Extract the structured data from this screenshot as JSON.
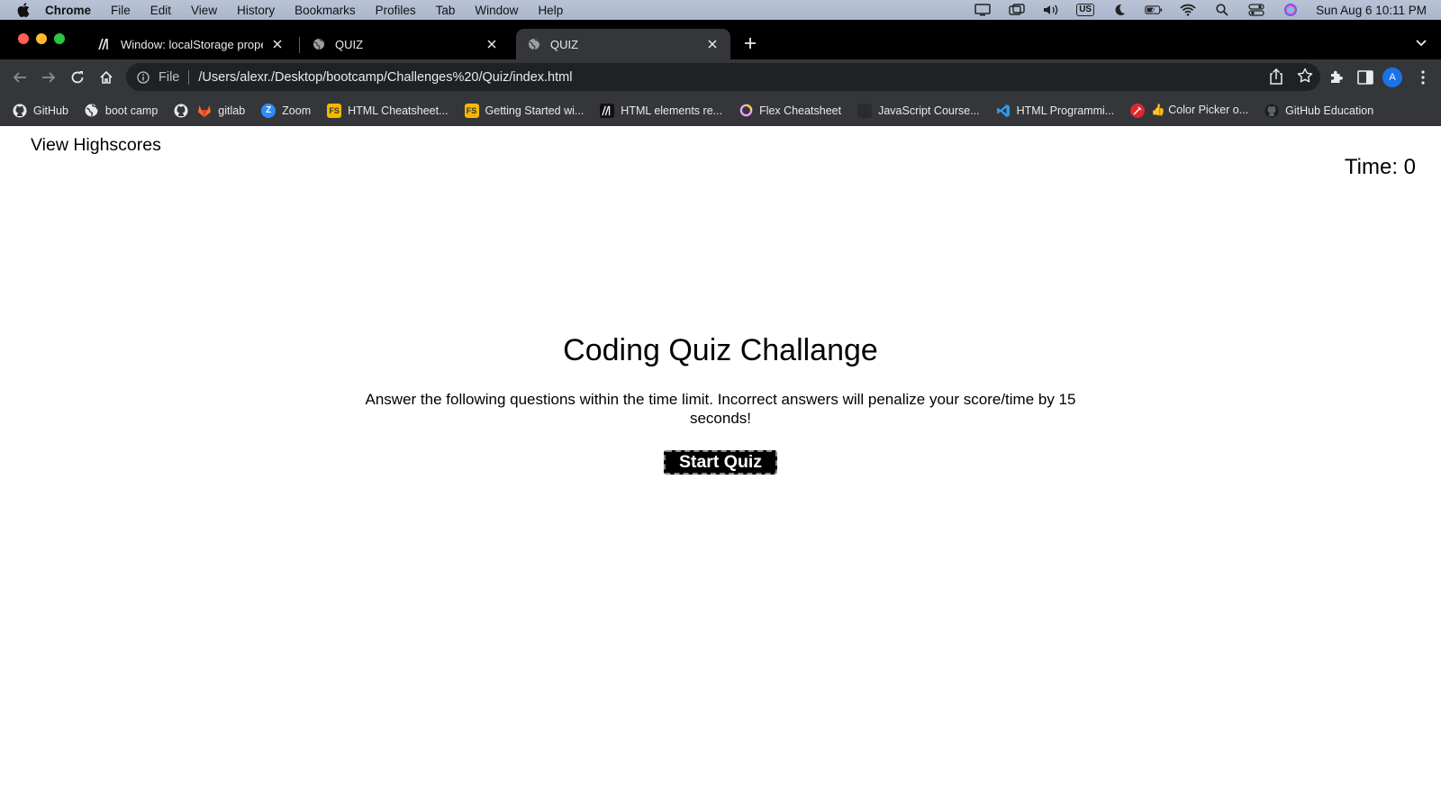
{
  "menubar": {
    "app_name": "Chrome",
    "items": [
      "File",
      "Edit",
      "View",
      "History",
      "Bookmarks",
      "Profiles",
      "Tab",
      "Window",
      "Help"
    ],
    "keyboard_layout": "US",
    "clock": "Sun Aug 6  10:11 PM"
  },
  "tabs": [
    {
      "title": "Window: localStorage property",
      "icon": "mdn-icon"
    },
    {
      "title": "QUIZ",
      "icon": "globe-icon"
    },
    {
      "title": "QUIZ",
      "icon": "globe-icon",
      "active": true
    }
  ],
  "toolbar": {
    "scheme_label": "File",
    "url": "/Users/alexr./Desktop/bootcamp/Challenges%20/Quiz/index.html",
    "avatar_letter": "A"
  },
  "bookmarks": [
    {
      "label": "GitHub",
      "icon": "github-icon"
    },
    {
      "label": "boot camp",
      "icon": "globe-icon"
    },
    {
      "label": "",
      "icon": "github-icon"
    },
    {
      "label": "gitlab",
      "icon": "gitlab-icon"
    },
    {
      "label": "Zoom",
      "icon": "zoom-icon"
    },
    {
      "label": "HTML Cheatsheet...",
      "icon": "fs-icon"
    },
    {
      "label": "Getting Started wi...",
      "icon": "fs-icon"
    },
    {
      "label": "HTML elements re...",
      "icon": "mdn-icon"
    },
    {
      "label": "Flex Cheatsheet",
      "icon": "ring-icon"
    },
    {
      "label": "JavaScript Course...",
      "icon": "blank-icon"
    },
    {
      "label": "HTML Programmi...",
      "icon": "vscode-icon"
    },
    {
      "label": "👍 Color Picker o...",
      "icon": "picker-icon"
    },
    {
      "label": "GitHub Education",
      "icon": "github-icon"
    }
  ],
  "page": {
    "view_highscores": "View Highscores",
    "timer": "Time: 0",
    "title": "Coding Quiz Challange",
    "description": "Answer the following questions within the time limit. Incorrect answers will penalize your score/time by 15 seconds!",
    "start_button": "Start Quiz"
  },
  "colors": {
    "tab_strip": "#000000",
    "toolbar": "#35363a",
    "omnibox": "#202124",
    "start_button_bg": "#000000",
    "start_button_text": "#ffffff"
  }
}
